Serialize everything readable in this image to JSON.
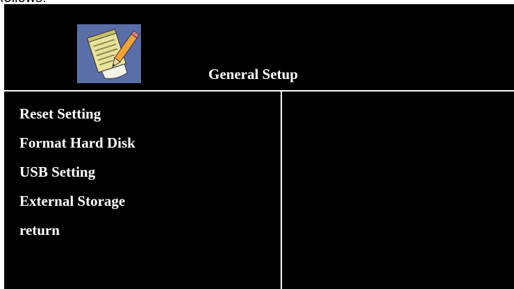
{
  "caption": "follows:",
  "header": {
    "title": "General Setup",
    "icon": "notepad-pencil-icon"
  },
  "menu": {
    "items": [
      {
        "label": "Reset Setting"
      },
      {
        "label": "Format Hard Disk"
      },
      {
        "label": "USB Setting"
      },
      {
        "label": "External Storage"
      },
      {
        "label": "return"
      }
    ]
  },
  "colors": {
    "background": "#000000",
    "text": "#ffffff",
    "divider": "#ffffff",
    "icon_bg": "#5a6ea8"
  }
}
